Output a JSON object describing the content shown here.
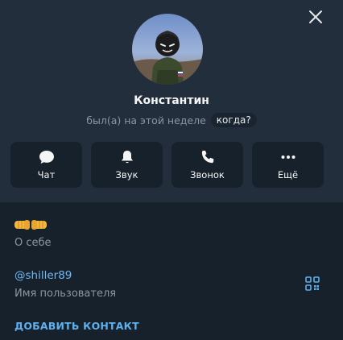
{
  "profile": {
    "name": "Константин",
    "status": "был(а) на этой неделе",
    "status_badge": "когда?"
  },
  "actions": [
    {
      "label": "Чат",
      "icon": "chat-bubble-icon"
    },
    {
      "label": "Звук",
      "icon": "bell-icon"
    },
    {
      "label": "Звонок",
      "icon": "phone-icon"
    },
    {
      "label": "Ещё",
      "icon": "more-dots-icon"
    }
  ],
  "info": {
    "about_emoji": "🤜🤛",
    "about_label": "О себе",
    "username": "@shiller89",
    "username_label": "Имя пользователя",
    "add_contact": "ДОБАВИТЬ КОНТАКТ"
  },
  "colors": {
    "background": "#17212b",
    "header": "#232e3c",
    "accent": "#71b8f2",
    "muted": "#8b96a3"
  }
}
